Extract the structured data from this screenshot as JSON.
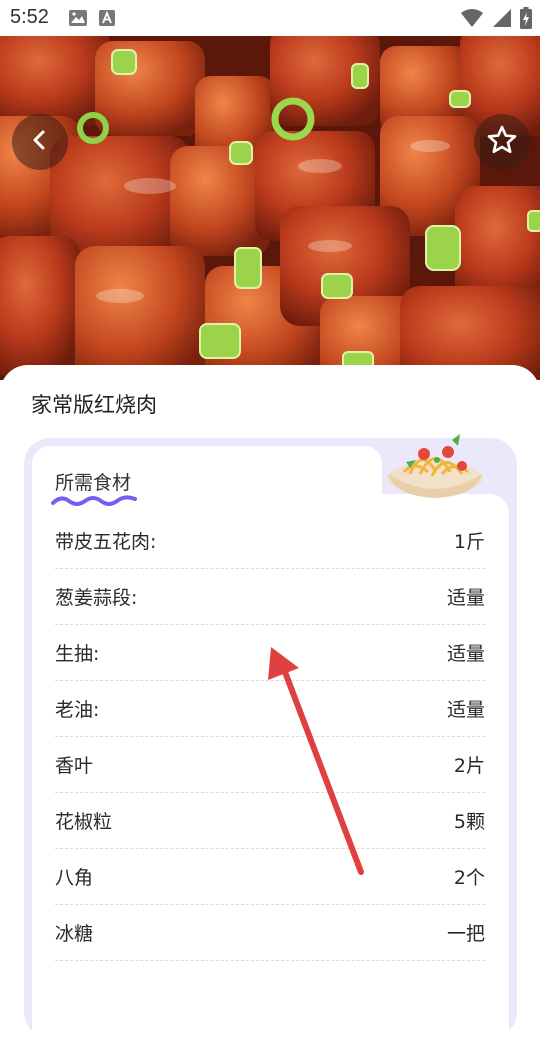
{
  "status": {
    "time": "5:52"
  },
  "recipe": {
    "title": "家常版红烧肉"
  },
  "ingredients": {
    "section_title": "所需食材",
    "rows": [
      {
        "name": "带皮五花肉:",
        "amount": "1斤"
      },
      {
        "name": "葱姜蒜段:",
        "amount": "适量"
      },
      {
        "name": "生抽:",
        "amount": "适量"
      },
      {
        "name": "老油:",
        "amount": "适量"
      },
      {
        "name": "香叶",
        "amount": "2片"
      },
      {
        "name": "花椒粒",
        "amount": "5颗"
      },
      {
        "name": "八角",
        "amount": "2个"
      },
      {
        "name": "冰糖",
        "amount": "一把"
      }
    ]
  },
  "colors": {
    "accent": "#e04040",
    "card_bg": "#ece8fb",
    "squiggle": "#7b5cf0"
  },
  "icons": [
    "back-icon",
    "star-icon",
    "gallery-icon",
    "a-icon",
    "wifi-icon",
    "signal-icon",
    "battery-icon",
    "bowl-icon"
  ]
}
